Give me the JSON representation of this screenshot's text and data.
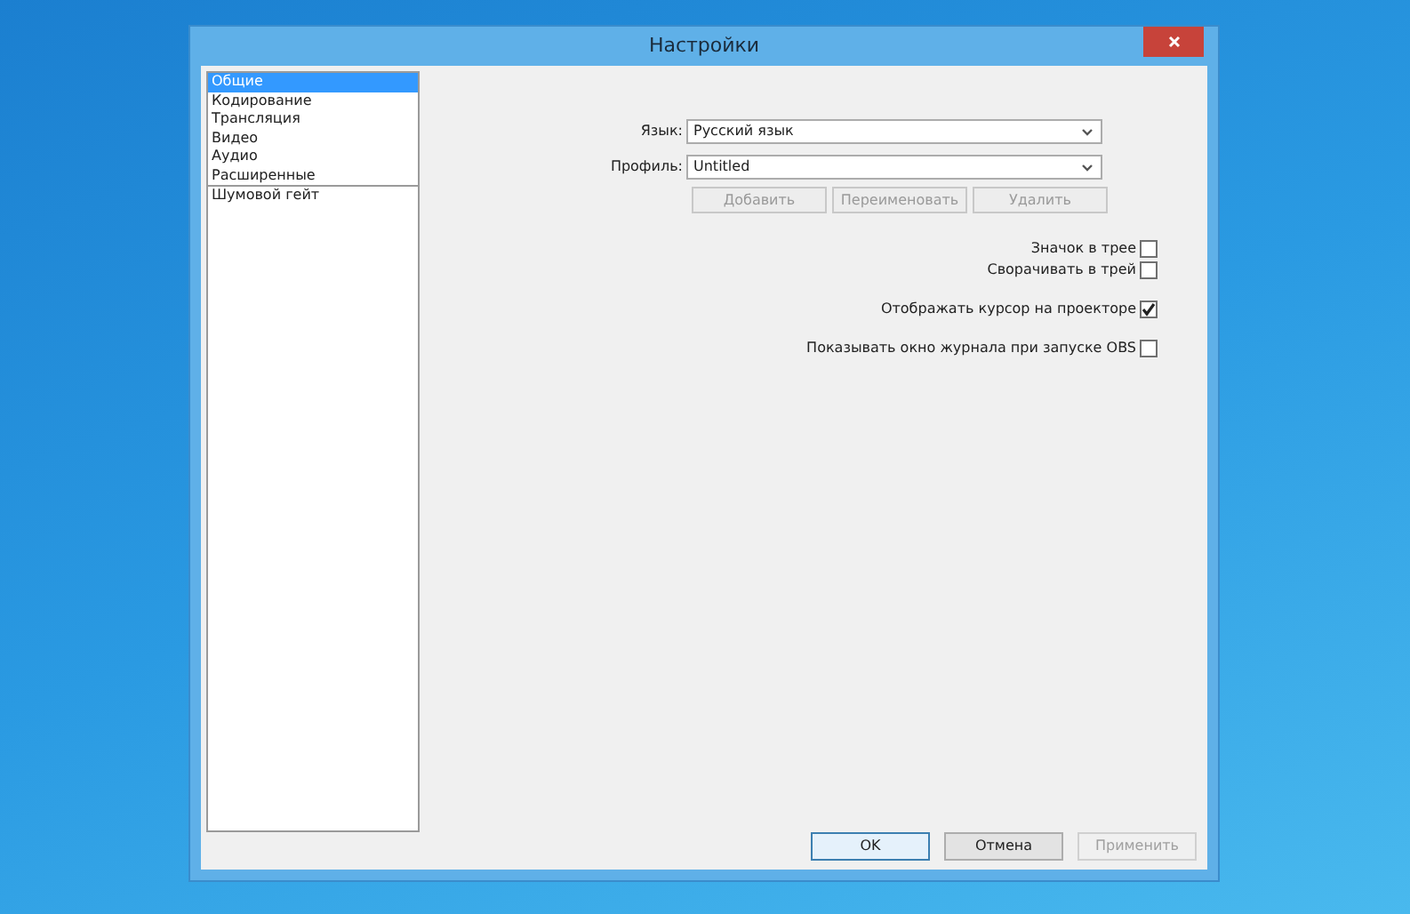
{
  "window": {
    "title": "Настройки"
  },
  "sidebar": {
    "groups": [
      {
        "items": [
          {
            "label": "Общие",
            "selected": true
          },
          {
            "label": "Кодирование",
            "selected": false
          },
          {
            "label": "Трансляция",
            "selected": false
          },
          {
            "label": "Видео",
            "selected": false
          },
          {
            "label": "Аудио",
            "selected": false
          },
          {
            "label": "Расширенные",
            "selected": false
          }
        ]
      },
      {
        "items": [
          {
            "label": "Шумовой гейт",
            "selected": false
          }
        ]
      }
    ]
  },
  "fields": [
    {
      "label": "Язык:",
      "value": "Русский язык"
    },
    {
      "label": "Профиль:",
      "value": "Untitled"
    }
  ],
  "profile_buttons": [
    {
      "label": "Добавить",
      "disabled": true
    },
    {
      "label": "Переименовать",
      "disabled": true
    },
    {
      "label": "Удалить",
      "disabled": true
    }
  ],
  "checkbox_groups": [
    [
      {
        "label": "Значок в трее",
        "checked": false
      },
      {
        "label": "Сворачивать в трей",
        "checked": false
      }
    ],
    [
      {
        "label": "Отображать курсор на проекторе",
        "checked": true
      }
    ],
    [
      {
        "label": "Показывать окно журнала при запуске OBS",
        "checked": false
      }
    ]
  ],
  "buttons": [
    {
      "label": "OK",
      "disabled": false,
      "default": true
    },
    {
      "label": "Отмена",
      "disabled": false,
      "default": false
    },
    {
      "label": "Применить",
      "disabled": true,
      "default": false
    }
  ]
}
